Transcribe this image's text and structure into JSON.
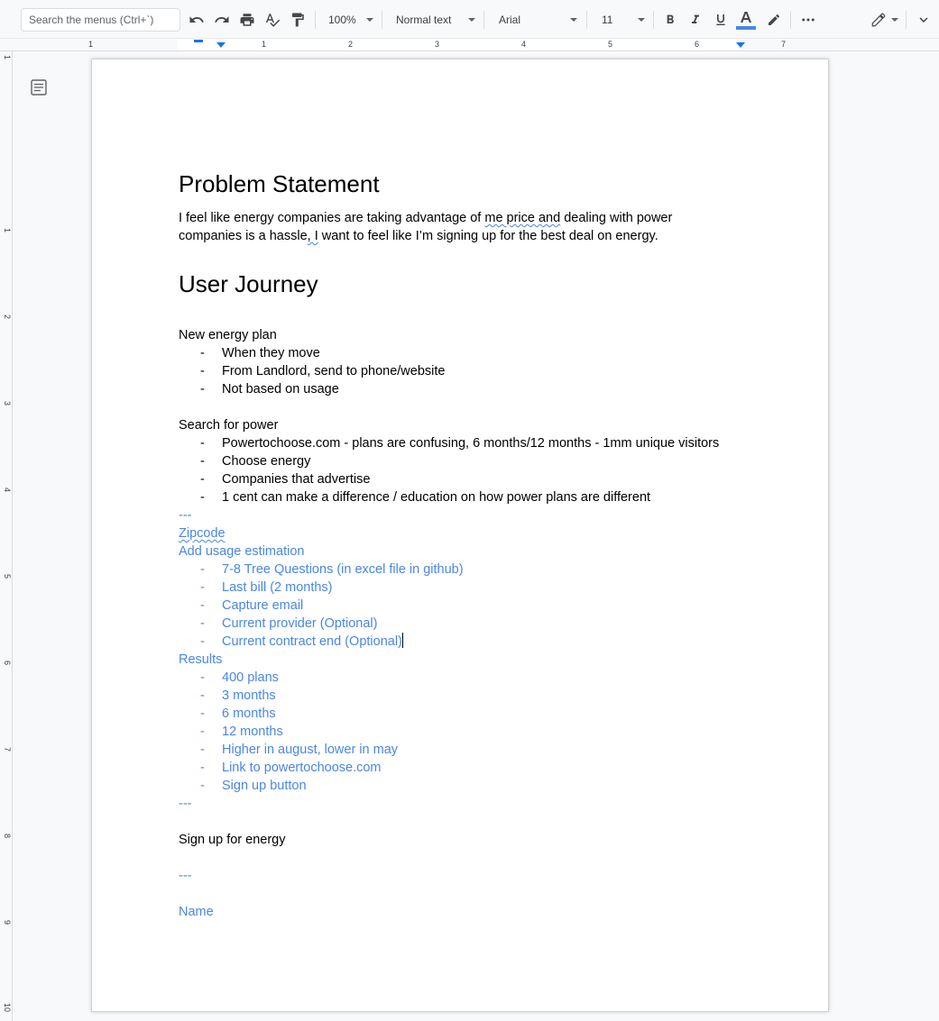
{
  "toolbar": {
    "search_placeholder": "Search the menus (Ctrl+`)",
    "zoom": "100%",
    "style": "Normal text",
    "font": "Arial",
    "font_size": "11"
  },
  "ruler": {
    "numbers": [
      "1",
      "1",
      "2",
      "3",
      "4",
      "5",
      "6",
      "7"
    ]
  },
  "vruler": {
    "numbers": [
      "1",
      "1",
      "2",
      "3",
      "4",
      "5",
      "6",
      "7",
      "8",
      "9",
      "10"
    ]
  },
  "doc": {
    "heading1": "Problem Statement",
    "problem_line1_a": "I feel like energy companies are taking advantage of ",
    "problem_line1_b": "me price and",
    "problem_line1_c": " dealing with power",
    "problem_line2_a": "companies is a hassle",
    "problem_line2_b": ", I",
    "problem_line2_c": " want to feel like I’m signing up for the best deal on energy.",
    "heading2": "User Journey",
    "new_energy_plan": "New energy plan",
    "new_energy_items": [
      "When they move",
      "From Landlord, send to phone/website",
      "Not based on usage"
    ],
    "search_for_power": "Search for power",
    "search_items": [
      "Powertochoose.com - plans are confusing, 6 months/12 months - 1mm unique visitors",
      "Choose energy",
      "Companies that advertise",
      "1 cent can make a difference / education on how power plans are different"
    ],
    "sep1": "---",
    "zipcode": "Zipcode",
    "add_usage": "Add usage estimation",
    "usage_items": [
      "7-8 Tree Questions (in excel file in github)",
      "Last bill (2 months)",
      "Capture email",
      "Current provider (Optional)",
      "Current contract end (Optional)"
    ],
    "results": "Results",
    "results_items": [
      "400 plans",
      "3 months",
      "6 months",
      "12 months",
      "Higher in august, lower in may",
      "Link to powertochoose.com",
      "Sign up button"
    ],
    "sep2": "---",
    "sign_up": "Sign up for energy",
    "sep3": "---",
    "name": "Name",
    "dash": "-"
  }
}
